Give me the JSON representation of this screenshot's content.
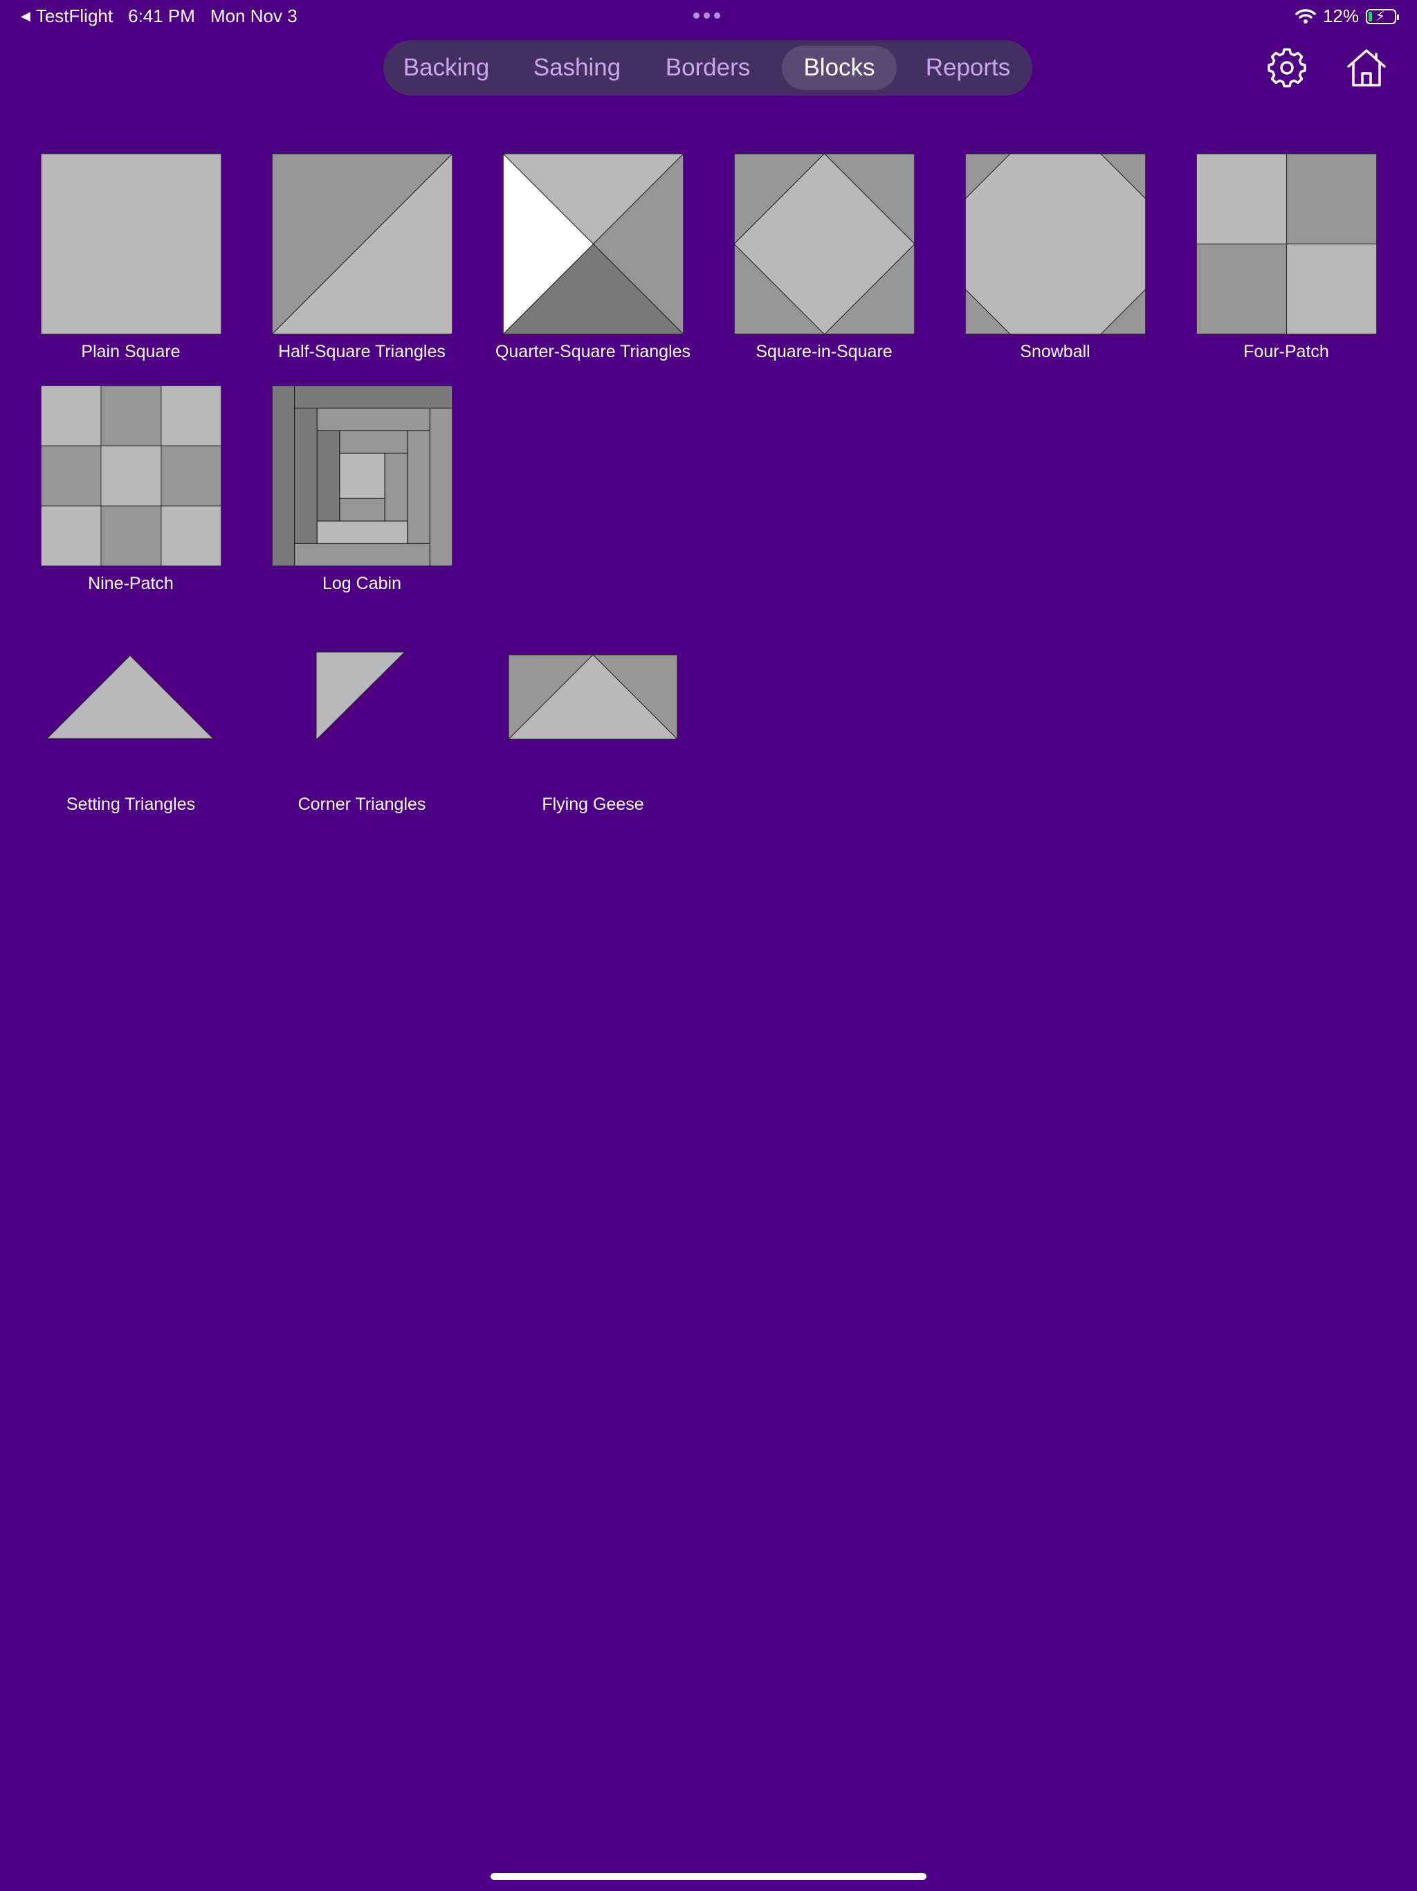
{
  "status_bar": {
    "back_app": "TestFlight",
    "time": "6:41 PM",
    "date": "Mon Nov 3",
    "battery": "12%"
  },
  "tabs": [
    {
      "label": "Backing",
      "active": false
    },
    {
      "label": "Sashing",
      "active": false
    },
    {
      "label": "Borders",
      "active": false
    },
    {
      "label": "Blocks",
      "active": true
    },
    {
      "label": "Reports",
      "active": false
    }
  ],
  "toolbar": {
    "settings_icon": "gear-icon",
    "home_icon": "house-icon"
  },
  "colors": {
    "background": "#4e0084",
    "fabric_light": "#b9b9b9",
    "fabric_medium": "#969696",
    "fabric_dark": "#7a7a7a",
    "fabric_white": "#ffffff"
  },
  "blocks": [
    {
      "label": "Plain Square"
    },
    {
      "label": "Half-Square Triangles"
    },
    {
      "label": "Quarter-Square Triangles"
    },
    {
      "label": "Square-in-Square"
    },
    {
      "label": "Snowball"
    },
    {
      "label": "Four-Patch"
    },
    {
      "label": "Nine-Patch"
    },
    {
      "label": "Log Cabin"
    }
  ],
  "setting_pieces": [
    {
      "label": "Setting Triangles"
    },
    {
      "label": "Corner Triangles"
    },
    {
      "label": "Flying Geese"
    }
  ]
}
